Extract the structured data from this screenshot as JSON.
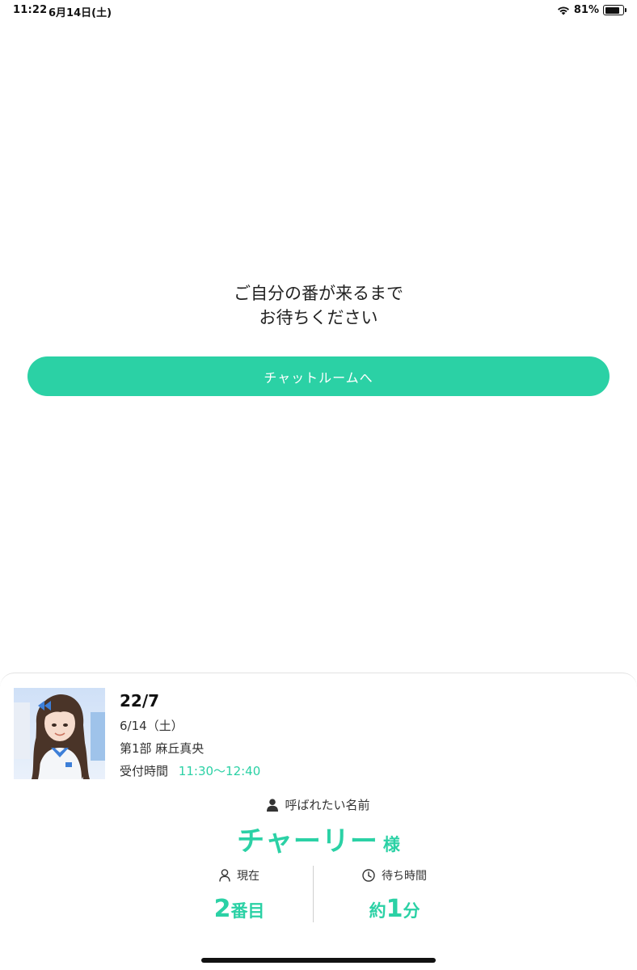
{
  "status_bar": {
    "time": "11:22",
    "date": "6月14日(土)",
    "battery_percent": "81%",
    "battery_level": 0.81
  },
  "wait": {
    "line1": "ご自分の番が来るまで",
    "line2": "お待ちください",
    "chat_button_label": "チャットルームへ"
  },
  "ticket": {
    "group": "22/7",
    "date": "6/14（土）",
    "session": "第1部  麻丘真央",
    "reception_label": "受付時間",
    "reception_time": "11:30〜12:40",
    "callname_label": "呼ばれたい名前",
    "callname": "チャーリー",
    "callname_suffix": "様",
    "current_label": "現在",
    "current_number": "2",
    "current_unit": "番目",
    "wait_label": "待ち時間",
    "wait_prefix": "約",
    "wait_number": "1",
    "wait_unit": "分"
  },
  "colors": {
    "accent": "#2bd1a5",
    "text": "#222222"
  }
}
